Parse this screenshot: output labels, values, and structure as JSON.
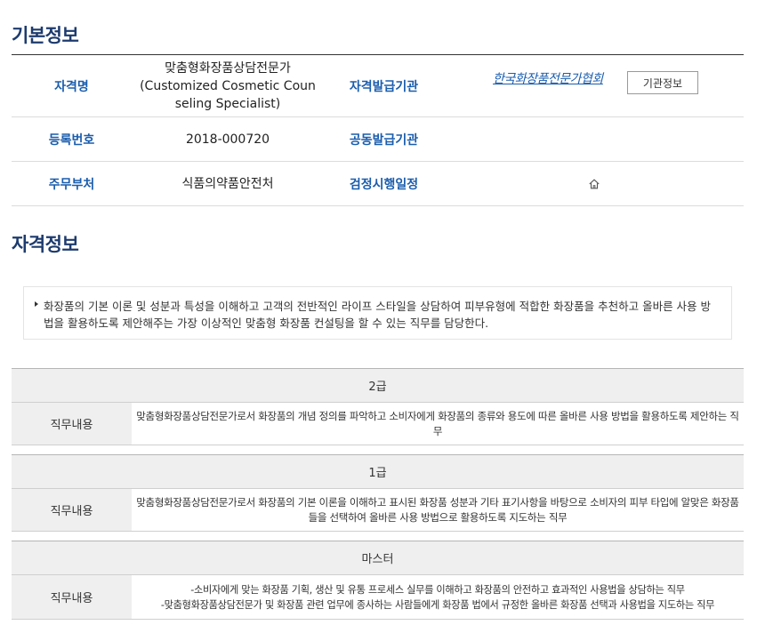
{
  "sections": {
    "basic_title": "기본정보",
    "qual_title": "자격정보"
  },
  "basic_info": {
    "rows": [
      {
        "label1": "자격명",
        "value1": "맞춤형화장품상담전문가\n(Customized Cosmetic Coun\nseling Specialist)",
        "label2": "자격발급기관"
      },
      {
        "label1": "등록번호",
        "value1": "2018-000720",
        "label2": "공동발급기관"
      },
      {
        "label1": "주무부처",
        "value1": "식품의약품안전처",
        "label2": "검정시행일정"
      }
    ],
    "issuer_link": "한국화장품전문가협회",
    "issuer_button": "기관정보",
    "schedule_icon": "home-icon"
  },
  "description": "화장품의 기본 이론 및 성분과 특성을 이해하고 고객의 전반적인 라이프 스타일을 상담하여 피부유형에 적합한 화장품을 추천하고 올바른 사용 방법을 활용하도록 제안해주는 가장 이상적인 맞춤형 화장품 컨설팅을 할 수 있는 직무를 담당한다.",
  "grades": [
    {
      "name": "2급",
      "label": "직무내용",
      "text": "맞춤형화장품상담전문가로서 화장품의 개념 정의를 파악하고 소비자에게 화장품의 종류와 용도에 따른 올바른 사용 방법을 활용하도록 제안하는 직무"
    },
    {
      "name": "1급",
      "label": "직무내용",
      "text": "맞춤형화장품상담전문가로서 화장품의 기본 이론을 이해하고 표시된 화장품 성분과 기타 표기사항을 바탕으로 소비자의 피부 타입에 알맞은 화장품들을 선택하여 올바른 사용 방법으로 활용하도록 지도하는 직무"
    },
    {
      "name": "마스터",
      "label": "직무내용",
      "text": "-소비자에게 맞는 화장품 기획, 생산 및 유통 프로세스 실무를 이해하고 화장품의 안전하고 효과적인 사용법을 상담하는 직무\n-맞춤형화장품상담전문가 및 화장품 관련 업무에 종사하는 사람들에게 화장품 법에서 규정한 올바른 화장품 선택과 사용법을 지도하는 직무"
    }
  ]
}
